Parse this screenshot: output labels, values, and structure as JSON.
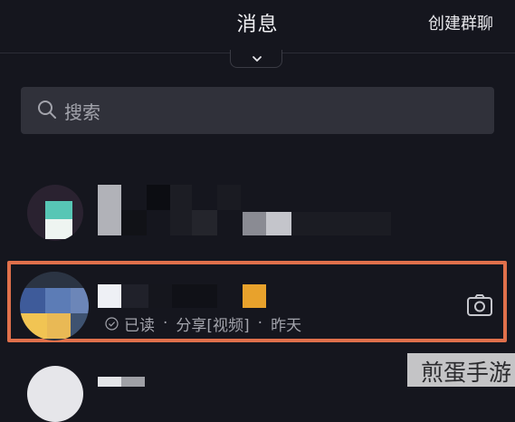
{
  "header": {
    "title": "消息",
    "create_group": "创建群聊"
  },
  "search": {
    "placeholder": "搜索"
  },
  "conversations": [
    {
      "name": "",
      "preview": "",
      "status": ""
    },
    {
      "name": "",
      "status": "已读",
      "separator": "·",
      "preview": "分享[视频]",
      "time": "昨天",
      "action_icon": "camera-icon"
    },
    {
      "name": "",
      "preview": ""
    }
  ],
  "watermark": "煎蛋手游",
  "colors": {
    "background": "#15161e",
    "highlight": "#e0704b",
    "search_bg": "#30313a"
  }
}
